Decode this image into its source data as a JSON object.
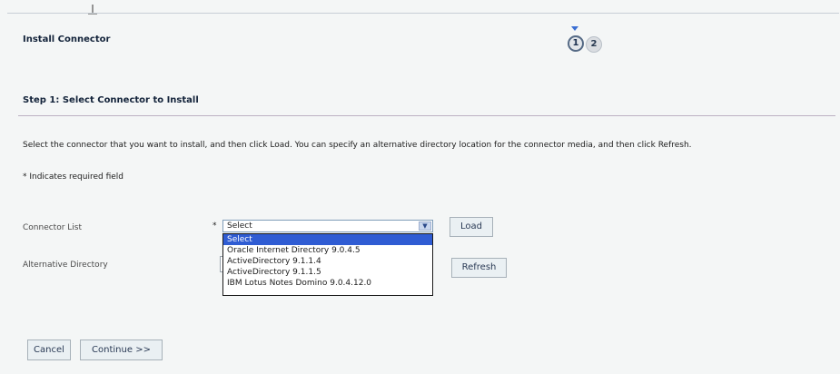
{
  "page": {
    "title": "Install Connector",
    "train": {
      "steps": [
        "1",
        "2"
      ],
      "current_step": 1
    },
    "step_heading": "Step 1: Select Connector to Install",
    "instructions": "Select the connector that you want to install, and then click Load.  You can specify an alternative directory location for the connector media, and then click Refresh.",
    "required_note": "* Indicates required field"
  },
  "form": {
    "connector_list": {
      "label": "Connector List",
      "required_marker": "*",
      "selected": "Select",
      "options": [
        "Select",
        "Oracle Internet Directory 9.0.4.5",
        "ActiveDirectory 9.1.1.4",
        "ActiveDirectory 9.1.1.5",
        "IBM Lotus Notes Domino 9.0.4.12.0"
      ]
    },
    "alternative_directory": {
      "label": "Alternative Directory"
    },
    "load_label": "Load",
    "refresh_label": "Refresh"
  },
  "footer": {
    "cancel_label": "Cancel",
    "continue_label": "Continue >>"
  },
  "colors": {
    "accent": "#2f5cd3",
    "background": "#f4f6f6",
    "button_bg": "#eaf0f3"
  }
}
